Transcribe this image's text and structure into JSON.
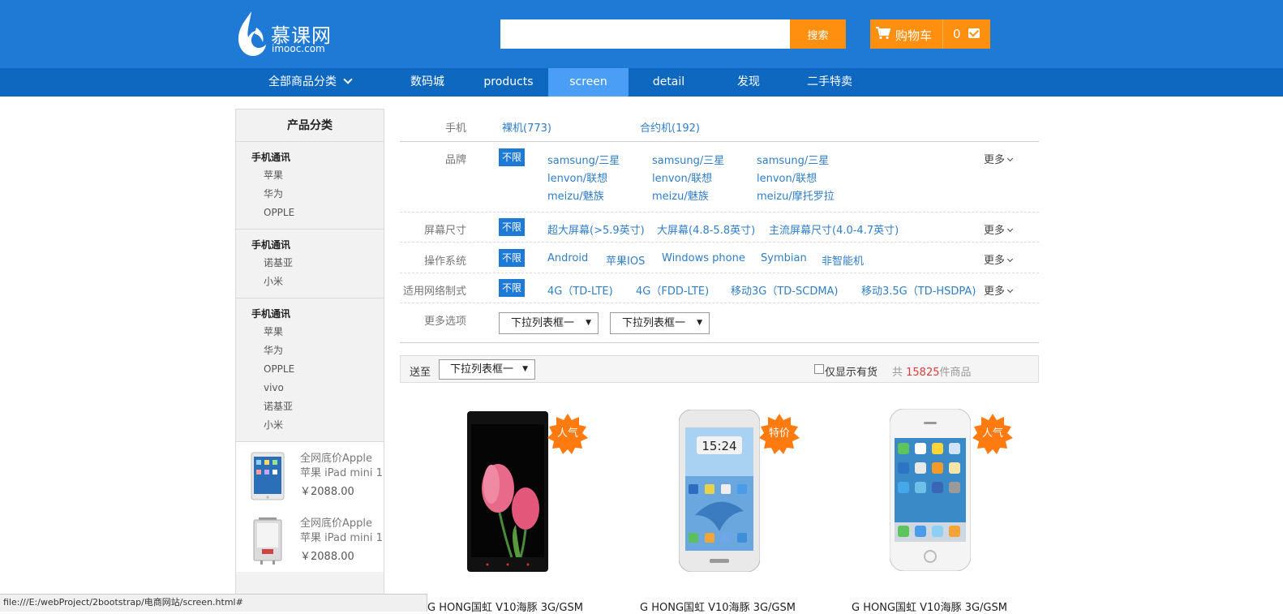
{
  "brand": {
    "name_cn": "慕课网",
    "name_en": "imooc.com"
  },
  "search": {
    "value": "",
    "placeholder": "",
    "button_label": "搜索"
  },
  "cart": {
    "label": "购物车",
    "count": "0"
  },
  "nav": {
    "category_label": "全部商品分类",
    "items": [
      {
        "label": "数码城"
      },
      {
        "label": "products"
      },
      {
        "label": "screen",
        "active": true
      },
      {
        "label": "detail"
      },
      {
        "label": "发现"
      },
      {
        "label": "二手特卖"
      }
    ]
  },
  "sidebar": {
    "title": "产品分类",
    "groups": [
      {
        "head": "手机通讯",
        "items": [
          "苹果",
          "华为",
          "OPPLE"
        ]
      },
      {
        "head": "手机通讯",
        "items": [
          "诺基亚",
          "小米"
        ]
      },
      {
        "head": "手机通讯",
        "items": [
          "苹果",
          "华为",
          "OPPLE",
          "vivo",
          "诺基亚",
          "小米"
        ]
      }
    ],
    "promos": [
      {
        "line1": "全网底价Apple",
        "line2": "苹果 iPad mini 1",
        "price": "￥2088.00"
      },
      {
        "line1": "全网底价Apple",
        "line2": "苹果 iPad mini 1",
        "price": "￥2088.00"
      }
    ]
  },
  "filters": {
    "phone": {
      "label": "手机",
      "options": [
        "裸机(773)",
        "合约机(192)"
      ]
    },
    "brand": {
      "label": "品牌",
      "all_label": "不限",
      "options": [
        "samsung/三星",
        "samsung/三星",
        "samsung/三星",
        "lenvon/联想",
        "lenvon/联想",
        "lenvon/联想",
        "meizu/魅族",
        "meizu/魅族",
        "meizu/摩托罗拉"
      ],
      "more_label": "更多"
    },
    "screen": {
      "label": "屏幕尺寸",
      "all_label": "不限",
      "options": [
        "超大屏幕(>5.9英寸)",
        "大屏幕(4.8-5.8英寸)",
        "主流屏幕尺寸(4.0-4.7英寸)"
      ],
      "more_label": "更多"
    },
    "os": {
      "label": "操作系统",
      "all_label": "不限",
      "options": [
        "Android",
        "苹果IOS",
        "Windows phone",
        "Symbian",
        "非智能机"
      ],
      "more_label": "更多"
    },
    "network": {
      "label": "适用网络制式",
      "all_label": "不限",
      "options": [
        "4G（TD-LTE)",
        "4G（FDD-LTE)",
        "移动3G（TD-SCDMA)",
        "移动3.5G（TD-HSDPA)"
      ],
      "more_label": "更多"
    },
    "more": {
      "label": "更多选项",
      "selects": [
        "下拉列表框一",
        "下拉列表框一"
      ]
    }
  },
  "toolbar": {
    "ship_label": "送至",
    "ship_select": "下拉列表框一",
    "in_stock_label": "仅显示有货",
    "count_prefix": "共 ",
    "count_value": "15825",
    "count_suffix": "件商品"
  },
  "products": [
    {
      "badge": "人气",
      "title": "G HONG国虹 V10海豚 3G/GSM"
    },
    {
      "badge": "特价",
      "title": "G HONG国虹 V10海豚 3G/GSM"
    },
    {
      "badge": "人气",
      "title": "G HONG国虹 V10海豚 3G/GSM"
    }
  ],
  "phone_screen_time": "15:24",
  "status_url": "file:///E:/webProject/2bootstrap/电商网站/screen.html#",
  "colors": {
    "header": "#1f7ad6",
    "nav": "#0e68c0",
    "accent": "#ff8f0f",
    "link": "#2f7ec6",
    "price_red": "#e4393c"
  }
}
